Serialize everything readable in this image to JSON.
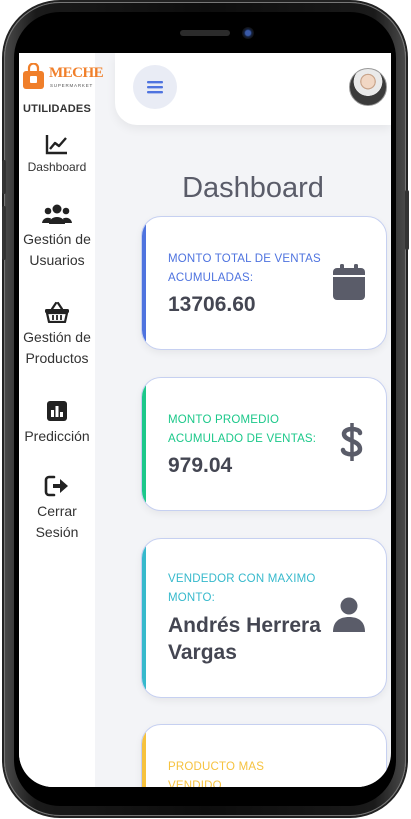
{
  "brand": {
    "name": "MECHE",
    "subtitle": "SUPERMARKET"
  },
  "sidebar": {
    "heading": "UTILIDADES",
    "items": [
      {
        "label": "Dashboard",
        "icon": "chart-line-icon"
      },
      {
        "label": "Gestión de Usuarios",
        "icon": "users-icon"
      },
      {
        "label": "Gestión de Productos",
        "icon": "basket-icon"
      },
      {
        "label": "Predicción",
        "icon": "poll-icon"
      },
      {
        "label": "Cerrar Sesión",
        "icon": "sign-out-icon"
      }
    ]
  },
  "topbar": {
    "menu_icon": "hamburger-icon",
    "avatar": "user-avatar"
  },
  "page": {
    "title": "Dashboard"
  },
  "cards": [
    {
      "label": "MONTO TOTAL DE VENTAS ACUMULADAS:",
      "value": "13706.60",
      "icon": "calendar-icon",
      "accent": "#4e73df"
    },
    {
      "label": "MONTO PROMEDIO ACUMULADO DE VENTAS:",
      "value": "979.04",
      "icon": "dollar-icon",
      "accent": "#1cc88a"
    },
    {
      "label": "VENDEDOR CON MAXIMO MONTO:",
      "value": "Andrés Herrera Vargas",
      "icon": "user-icon",
      "accent": "#36b9cc"
    },
    {
      "label": "PRODUCTO MAS VENDIDO",
      "value": "",
      "icon": "",
      "accent": "#f6c23e"
    }
  ],
  "colors": {
    "brand_orange": "#f07f2a",
    "text_dark": "#5a5c69"
  }
}
